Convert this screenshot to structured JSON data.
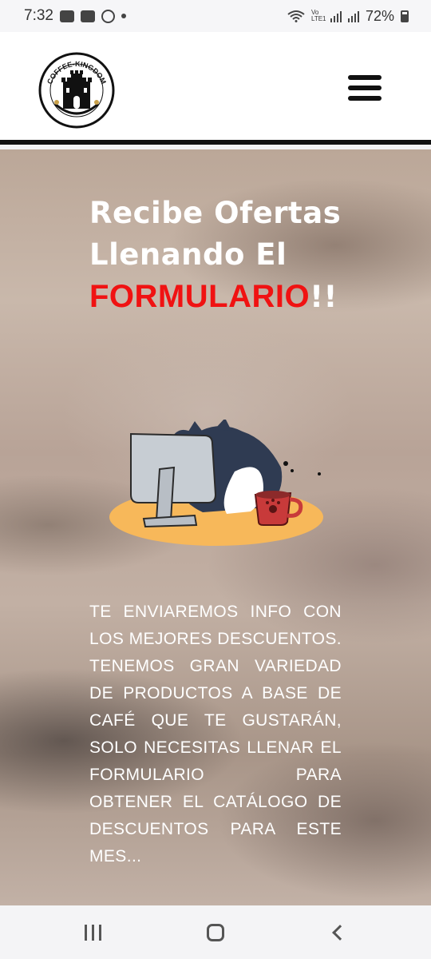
{
  "status_bar": {
    "time": "7:32",
    "left_icons": [
      "image-icon",
      "youtube-icon",
      "whatsapp-icon",
      "notification-dot-icon"
    ],
    "network_label": "Vo LTE1",
    "battery": "72%"
  },
  "header": {
    "logo_text": "COFFEE-KINGDOM",
    "menu_icon": "hamburger-menu-icon"
  },
  "hero": {
    "title_line1": "Recibe Ofertas",
    "title_line2": "Llenando El",
    "title_highlight": "FORMULARIO",
    "title_suffix": "!!",
    "body": "TE ENVIAREMOS INFO CON LOS MEJORES DESCUENTOS. TENEMOS GRAN VARIEDAD DE PRODUCTOS A BASE DE CAFÉ QUE TE GUSTARÁN, SOLO NECESITAS LLENAR EL FORMULARIO PARA OBTENER EL CATÁLOGO DE DESCUENTOS PARA ESTE MES...",
    "illustration": "sleeping-cat-computer-coffee"
  },
  "colors": {
    "accent_red": "#f01212",
    "header_border": "#111111"
  },
  "nav_bar": {
    "buttons": [
      "recents-icon",
      "home-icon",
      "back-icon"
    ]
  }
}
